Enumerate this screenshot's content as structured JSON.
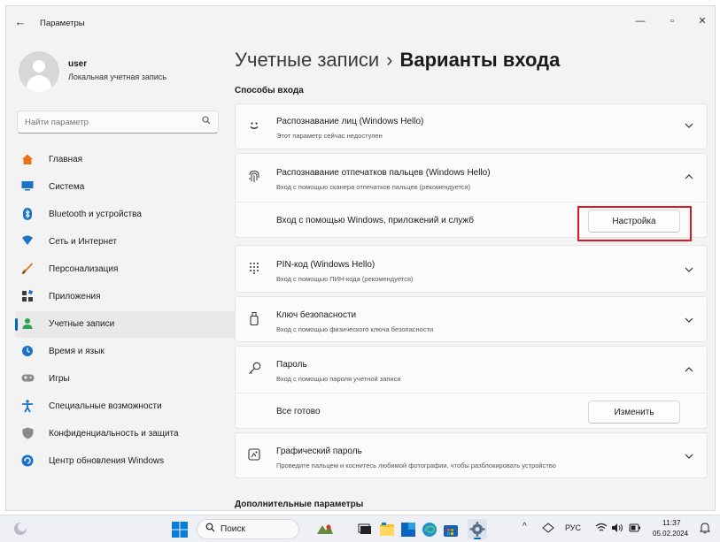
{
  "window": {
    "title": "Параметры",
    "back_glyph": "←",
    "minimize_glyph": "—",
    "maximize_glyph": "▫",
    "close_glyph": "✕"
  },
  "account": {
    "name": "user",
    "type": "Локальная учетная запись"
  },
  "search": {
    "placeholder": "Найти параметр",
    "icon": "search-icon"
  },
  "sidebar": {
    "items": [
      {
        "label": "Главная",
        "icon": "home-icon",
        "color": "#e8731a"
      },
      {
        "label": "Система",
        "icon": "system-icon",
        "color": "#1a73c9"
      },
      {
        "label": "Bluetooth и устройства",
        "icon": "bluetooth-icon",
        "color": "#1a73c9"
      },
      {
        "label": "Сеть и Интернет",
        "icon": "network-icon",
        "color": "#1a73c9"
      },
      {
        "label": "Персонализация",
        "icon": "brush-icon",
        "color": "#d9822b"
      },
      {
        "label": "Приложения",
        "icon": "apps-icon",
        "color": "#3c3c3c"
      },
      {
        "label": "Учетные записи",
        "icon": "account-icon",
        "color": "#2aa55a",
        "active": true
      },
      {
        "label": "Время и язык",
        "icon": "globe-clock-icon",
        "color": "#1a73c9"
      },
      {
        "label": "Игры",
        "icon": "gamepad-icon",
        "color": "#7a7a7a"
      },
      {
        "label": "Специальные возможности",
        "icon": "accessibility-icon",
        "color": "#1a73c9"
      },
      {
        "label": "Конфиденциальность и защита",
        "icon": "shield-icon",
        "color": "#8a8a8a"
      },
      {
        "label": "Центр обновления Windows",
        "icon": "update-icon",
        "color": "#1a73c9"
      }
    ]
  },
  "header": {
    "breadcrumb": "Учетные записи",
    "separator": "›",
    "current": "Варианты входа"
  },
  "sections": {
    "signin_methods": "Способы входа",
    "additional": "Дополнительные параметры"
  },
  "options": {
    "face": {
      "title": "Распознавание лиц (Windows Hello)",
      "subtitle": "Этот параметр сейчас недоступен",
      "icon": "face-icon",
      "chevron": "⌄"
    },
    "fingerprint": {
      "title": "Распознавание отпечатков пальцев (Windows Hello)",
      "subtitle": "Вход с помощью сканера отпечатков пальцев (рекомендуется)",
      "icon": "fingerprint-icon",
      "chevron": "⌃",
      "sub_label": "Вход с помощью Windows, приложений и служб",
      "button": "Настройка"
    },
    "pin": {
      "title": "PIN-код (Windows Hello)",
      "subtitle": "Вход с помощью ПИН-кода (рекомендуется)",
      "icon": "keypad-icon",
      "chevron": "⌄"
    },
    "security_key": {
      "title": "Ключ безопасности",
      "subtitle": "Вход с помощью физического ключа безопасности",
      "icon": "usb-key-icon",
      "chevron": "⌄"
    },
    "password": {
      "title": "Пароль",
      "subtitle": "Вход с помощью пароля учетной записи",
      "icon": "key-icon",
      "chevron": "⌃",
      "sub_label": "Все готово",
      "button": "Изменить"
    },
    "picture_password": {
      "title": "Графический пароль",
      "subtitle": "Проведите пальцем и коснитесь любимой фотографии, чтобы разблокировать устройство",
      "icon": "picture-password-icon",
      "chevron": "⌄"
    }
  },
  "taskbar": {
    "search_label": "Поиск",
    "tray_caret": "^",
    "language": "РУС",
    "time": "11:37",
    "date": "05.02.2024",
    "accent": "#0067c0"
  }
}
